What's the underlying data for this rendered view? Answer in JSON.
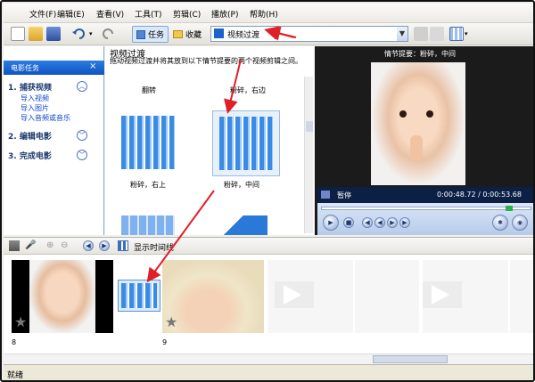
{
  "menu": [
    "文件(F)",
    "编辑(E)",
    "查看(V)",
    "工具(T)",
    "剪辑(C)",
    "播放(P)",
    "帮助(H)"
  ],
  "toolbar": {
    "tasks_label": "任务",
    "collections_label": "收藏",
    "combo_value": "视频过渡"
  },
  "tasks_pane": {
    "title": "电影任务",
    "close": "×",
    "sections": [
      {
        "label": "1. 捕获视频",
        "expanded": true,
        "links": [
          "导入视频",
          "导入图片",
          "导入音频或音乐"
        ]
      },
      {
        "label": "2. 编辑电影",
        "expanded": false,
        "links": []
      },
      {
        "label": "3. 完成电影",
        "expanded": false,
        "links": []
      }
    ]
  },
  "collection": {
    "title": "视频过渡",
    "description": "拖动视频过渡并将其放到以下情节提要的两个视频剪辑之间。",
    "items": [
      "翻转",
      "粉碎，右边",
      "粉碎，右上",
      "粉碎，中间"
    ]
  },
  "preview": {
    "header": "情节提要：粉碎，中间",
    "status": "暂停",
    "time": "0:00:48.72 / 0:00:53.68"
  },
  "storyboard": {
    "show_timeline": "显示时间线",
    "clip_numbers": [
      "8",
      "9"
    ]
  },
  "statusbar": {
    "text": "就绪"
  },
  "colors": {
    "accent": "#0e55c2",
    "arrow": "#e01f26",
    "link": "#1346c9"
  }
}
